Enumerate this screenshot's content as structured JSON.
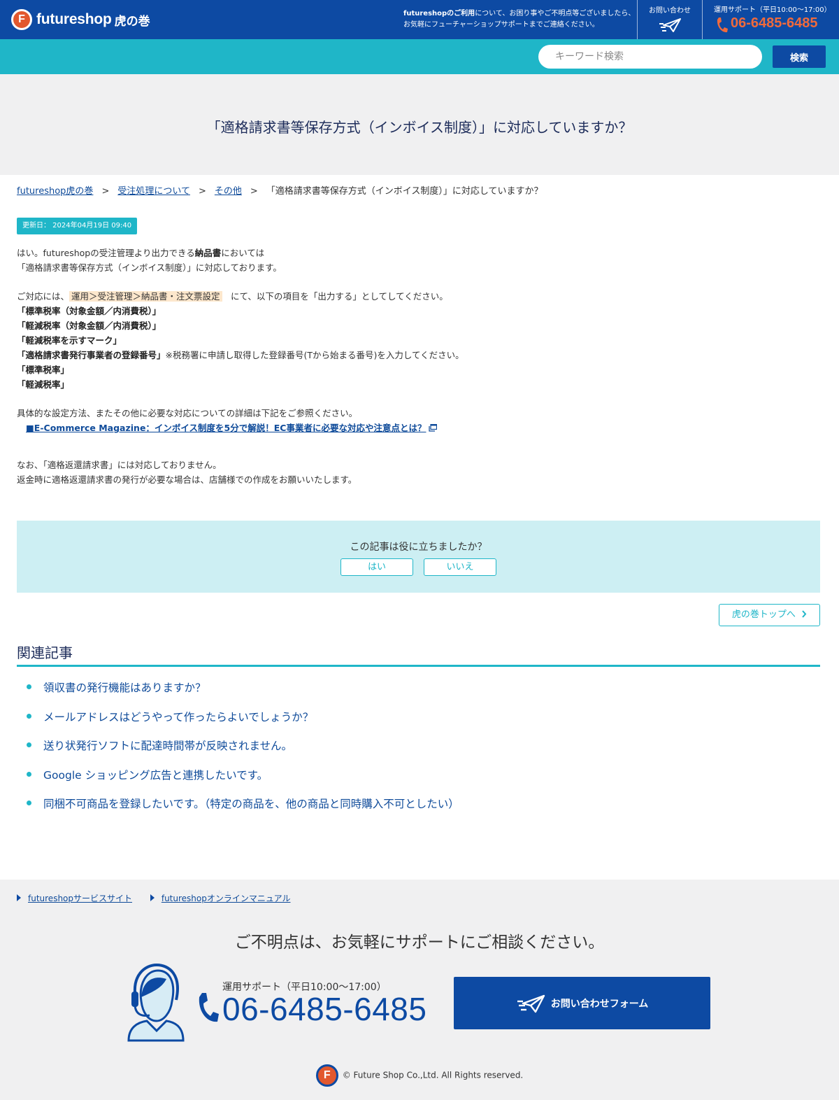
{
  "header": {
    "logo_mark": "F",
    "logo_text": "futureshop",
    "logo_sub": "虎の巻",
    "msg_bold": "futureshopのご利用",
    "msg_line1": "について、お困り事やご不明点等ございましたら、",
    "msg_line2": "お気軽にフューチャーショップサポートまでご連絡ください。",
    "contact_label": "お問い合わせ",
    "support_hours": "運用サポート（平日10:00〜17:00）",
    "support_phone": "06-6485-6485"
  },
  "search": {
    "placeholder": "キーワード検索",
    "button_label": "検索"
  },
  "page_title": "「適格請求書等保存方式（インボイス制度）」に対応していますか？",
  "breadcrumb": {
    "items": [
      "futureshop虎の巻",
      "受注処理について",
      "その他"
    ],
    "current": "「適格請求書等保存方式（インボイス制度）」に対応していますか？",
    "separator": ">"
  },
  "updated": "更新日： 2024年04月19日 09:40",
  "article": {
    "p1_pre": "はい。futureshopの受注管理より出力できる",
    "p1_bold": "納品書",
    "p1_post": "においては",
    "p1_line2": "「適格請求書等保存方式（インボイス制度）」に対応しております。",
    "p2_pre": "ご対応には、",
    "p2_highlight": "運用＞受注管理＞納品書・注文票設定",
    "p2_post": "　にて、以下の項目を「出力する」としてしてください。",
    "items": [
      "「標準税率（対象金額／内消費税）」",
      "「軽減税率（対象金額／内消費税）」",
      "「軽減税率を示すマーク」",
      "「適格請求書発行事業者の登録番号」"
    ],
    "item4_note": "※税務署に申請し取得した登録番号(Tから始まる番号)を入力してください。",
    "items2": [
      "「標準税率」",
      "「軽減税率」"
    ],
    "p3": "具体的な設定方法、またその他に必要な対応についての詳細は下記をご参照ください。",
    "link": "■E-Commerce Magazine：インボイス制度を5分で解説！EC事業者に必要な対応や注意点とは？",
    "p4_line1": "なお、「適格返還請求書」には対応しておりません。",
    "p4_line2": "返金時に適格返還請求書の発行が必要な場合は、店舗様での作成をお願いいたします。"
  },
  "feedback": {
    "question": "この記事は役に立ちましたか？",
    "yes": "はい",
    "no": "いいえ"
  },
  "top_link": "虎の巻トップへ",
  "related": {
    "title": "関連記事",
    "items": [
      "領収書の発行機能はありますか？",
      "メールアドレスはどうやって作ったらよいでしょうか？",
      "送り状発行ソフトに配達時間帯が反映されません。",
      "Google ショッピング広告と連携したいです。",
      "同梱不可商品を登録したいです。（特定の商品を、他の商品と同時購入不可としたい）"
    ]
  },
  "footer": {
    "links": [
      "futureshopサービスサイト",
      "futureshopオンラインマニュアル"
    ],
    "heading": "ご不明点は、お気軽にサポートにご相談ください。",
    "hours": "運用サポート（平日10:00〜17:00）",
    "phone": "06-6485-6485",
    "contact_button": "お問い合わせフォーム",
    "logo_mark": "F",
    "copyright": "© Future Shop Co.,Ltd. All Rights reserved."
  },
  "colors": {
    "brand_blue": "#0d4aa3",
    "accent_teal": "#1fb6c8",
    "phone_orange": "#f06a3c",
    "logo_orange": "#e2582e"
  },
  "icons": [
    "paper-plane-icon",
    "phone-icon",
    "external-link-icon",
    "chevron-right-icon",
    "operator-icon"
  ]
}
